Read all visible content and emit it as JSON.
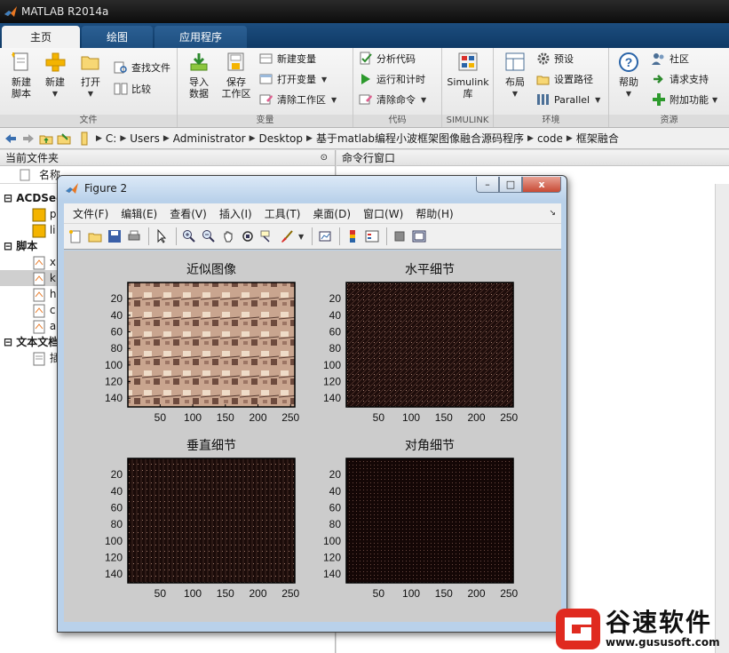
{
  "app": {
    "title": "MATLAB R2014a"
  },
  "tabs": [
    {
      "label": "主页",
      "active": true
    },
    {
      "label": "绘图",
      "active": false
    },
    {
      "label": "应用程序",
      "active": false
    }
  ],
  "ribbon": {
    "file": {
      "name": "文件",
      "new_script": [
        "新建",
        "脚本"
      ],
      "new": "新建",
      "open": "打开",
      "find_files": "查找文件",
      "compare": "比较"
    },
    "variable": {
      "name": "变量",
      "import": [
        "导入",
        "数据"
      ],
      "save": [
        "保存",
        "工作区"
      ],
      "new_var": "新建变量",
      "open_var": "打开变量",
      "clear_ws": "清除工作区"
    },
    "code": {
      "name": "代码",
      "analyze": "分析代码",
      "run_time": "运行和计时",
      "clear_cmd": "清除命令"
    },
    "simulink": {
      "name": "SIMULINK",
      "label": [
        "Simulink",
        "库"
      ]
    },
    "env": {
      "name": "环境",
      "layout": "布局",
      "prefs": "预设",
      "set_path": "设置路径",
      "parallel": "Parallel"
    },
    "resources": {
      "name": "资源",
      "help": "帮助",
      "community": "社区",
      "support": "请求支持",
      "addons": "附加功能"
    }
  },
  "address": {
    "path": [
      "C:",
      "Users",
      "Administrator",
      "Desktop",
      "基于matlab编程小波框架图像融合源码程序",
      "code",
      "框架融合"
    ]
  },
  "current_folder": {
    "title": "当前文件夹",
    "column_name": "名称",
    "sections": [
      {
        "label": "ACDSee",
        "items": [
          "p",
          "li"
        ]
      },
      {
        "label": "脚本",
        "items": [
          "x",
          "k",
          "h",
          "c",
          "a"
        ]
      },
      {
        "label": "文本文档",
        "items": [
          "插"
        ]
      }
    ]
  },
  "command_window": {
    "title": "命令行窗口"
  },
  "figure": {
    "title": "Figure 2",
    "menu": [
      "文件(F)",
      "编辑(E)",
      "查看(V)",
      "插入(I)",
      "工具(T)",
      "桌面(D)",
      "窗口(W)",
      "帮助(H)"
    ],
    "window_buttons": {
      "minimize": "–",
      "maximize": "□",
      "close": "x"
    }
  },
  "chart_data": [
    {
      "type": "heatmap",
      "title": "近似图像",
      "xticks": [
        50,
        100,
        150,
        200,
        250
      ],
      "yticks": [
        20,
        40,
        60,
        80,
        100,
        120,
        140
      ],
      "xlim": [
        0.5,
        256.5
      ],
      "ylim": [
        0.5,
        150.5
      ],
      "colormap": "pink"
    },
    {
      "type": "heatmap",
      "title": "水平细节",
      "xticks": [
        50,
        100,
        150,
        200,
        250
      ],
      "yticks": [
        20,
        40,
        60,
        80,
        100,
        120,
        140
      ],
      "xlim": [
        0.5,
        256.5
      ],
      "ylim": [
        0.5,
        150.5
      ],
      "colormap": "pink"
    },
    {
      "type": "heatmap",
      "title": "垂直细节",
      "xticks": [
        50,
        100,
        150,
        200,
        250
      ],
      "yticks": [
        20,
        40,
        60,
        80,
        100,
        120,
        140
      ],
      "xlim": [
        0.5,
        256.5
      ],
      "ylim": [
        0.5,
        150.5
      ],
      "colormap": "pink"
    },
    {
      "type": "heatmap",
      "title": "对角细节",
      "xticks": [
        50,
        100,
        150,
        200,
        250
      ],
      "yticks": [
        20,
        40,
        60,
        80,
        100,
        120,
        140
      ],
      "xlim": [
        0.5,
        256.5
      ],
      "ylim": [
        0.5,
        150.5
      ],
      "colormap": "pink"
    }
  ],
  "watermark": {
    "name": "谷速软件",
    "url": "www.gususoft.com"
  },
  "colors": {
    "tab_bar": "#0f3a66",
    "figure_frame": "#b9d1ea",
    "axes_bg": "#cccccc",
    "close_btn": "#c74a35",
    "watermark_red": "#e02a1f"
  }
}
